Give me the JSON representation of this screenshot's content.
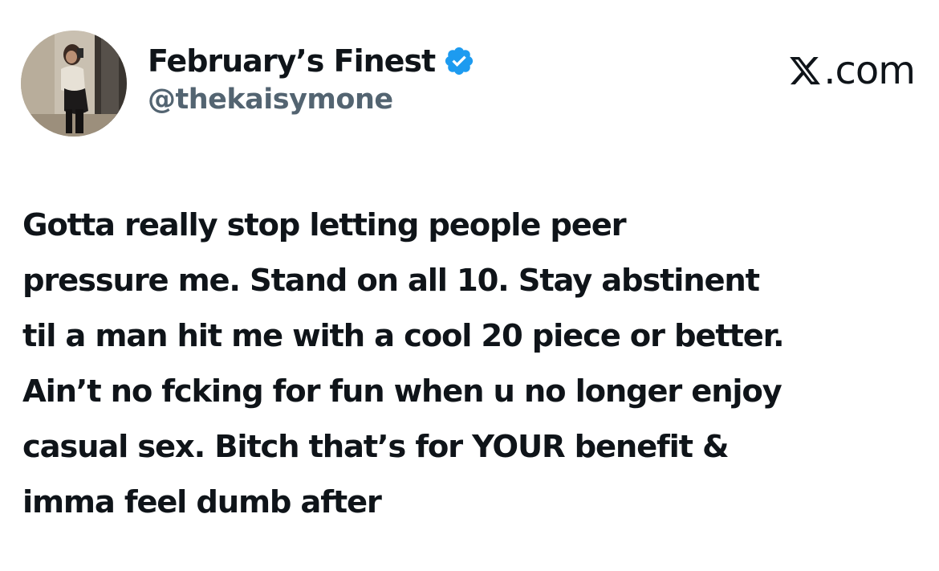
{
  "author": {
    "display_name": "February’s Finest",
    "handle": "@thekaisymone",
    "verified": true,
    "verified_icon": "verified-badge-icon",
    "verified_color": "#1d9bf0",
    "avatar_icon": "profile-photo"
  },
  "brand": {
    "logo_icon": "x-logo-icon",
    "text": ".com"
  },
  "tweet": {
    "lines": [
      "Gotta really stop letting people peer",
      "pressure me. Stand on all 10. Stay abstinent",
      "til a man hit me with a cool 20 piece or better.",
      "Ain’t no fcking for fun when u no longer enjoy",
      "casual sex. Bitch that’s for YOUR benefit &",
      "imma feel dumb after"
    ]
  },
  "colors": {
    "text": "#0f1419",
    "secondary_text": "#536471",
    "background": "#ffffff"
  }
}
